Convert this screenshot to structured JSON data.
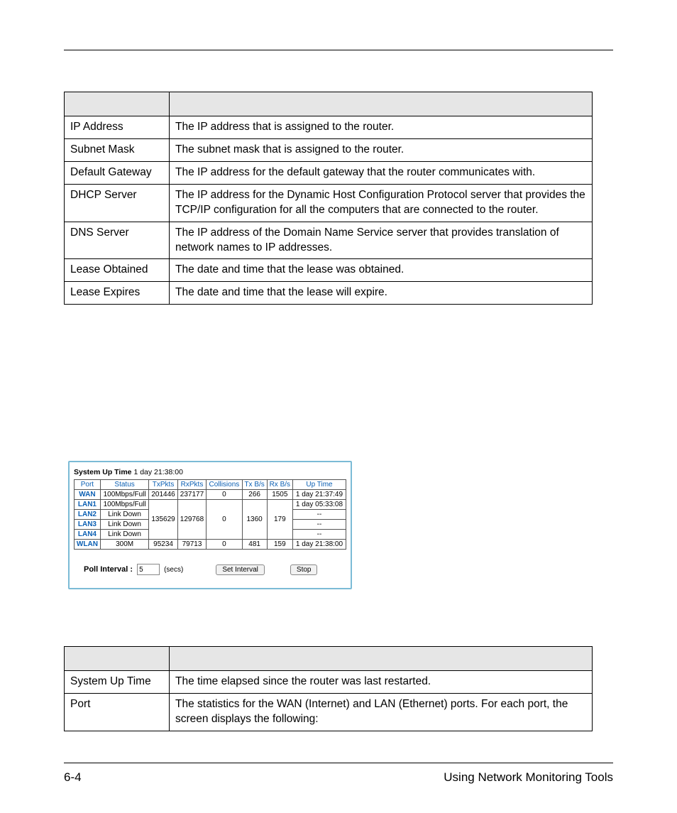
{
  "table1": {
    "rows": [
      {
        "field": "IP Address",
        "desc": "The IP address that is assigned to the router."
      },
      {
        "field": "Subnet Mask",
        "desc": "The subnet mask that is assigned to the router."
      },
      {
        "field": "Default Gateway",
        "desc": "The IP address for the default gateway that the router communicates with."
      },
      {
        "field": "DHCP Server",
        "desc": "The IP address for the Dynamic Host Configuration Protocol server that provides the TCP/IP configuration for all the computers that are connected to the router."
      },
      {
        "field": "DNS Server",
        "desc": "The IP address of the Domain Name Service server that provides translation of network names to IP addresses."
      },
      {
        "field": "Lease Obtained",
        "desc": "The date and time that the lease was obtained."
      },
      {
        "field": "Lease Expires",
        "desc": "The date and time that the lease will expire."
      }
    ]
  },
  "stats_panel": {
    "uptime_label": "System Up Time",
    "uptime_value": "1 day 21:38:00",
    "headers": [
      "Port",
      "Status",
      "TxPkts",
      "RxPkts",
      "Collisions",
      "Tx B/s",
      "Rx B/s",
      "Up Time"
    ],
    "rows": [
      {
        "port": "WAN",
        "status": "100Mbps/Full",
        "tx": "201446",
        "rx": "237177",
        "col": "0",
        "txbs": "266",
        "rxbs": "1505",
        "up": "1 day 21:37:49"
      },
      {
        "port": "LAN1",
        "status": "100Mbps/Full",
        "up": "1 day 05:33:08"
      },
      {
        "port": "LAN2",
        "status": "Link Down",
        "up": "--"
      },
      {
        "port": "LAN3",
        "status": "Link Down",
        "up": "--"
      },
      {
        "port": "LAN4",
        "status": "Link Down",
        "up": "--"
      },
      {
        "port": "WLAN",
        "status": "300M",
        "tx": "95234",
        "rx": "79713",
        "col": "0",
        "txbs": "481",
        "rxbs": "159",
        "up": "1 day 21:38:00"
      }
    ],
    "lan_group": {
      "tx": "135629",
      "rx": "129768",
      "col": "0",
      "txbs": "1360",
      "rxbs": "179"
    },
    "poll_label": "Poll Interval :",
    "poll_value": "5",
    "secs_label": "(secs)",
    "set_interval_btn": "Set Interval",
    "stop_btn": "Stop"
  },
  "table2": {
    "rows": [
      {
        "field": "System Up Time",
        "desc": "The time elapsed since the router was last restarted."
      },
      {
        "field": "Port",
        "desc": "The statistics for the WAN (Internet) and LAN (Ethernet) ports. For each port, the screen displays the following:"
      }
    ]
  },
  "footer": {
    "page_num": "6-4",
    "title": "Using Network Monitoring Tools"
  }
}
